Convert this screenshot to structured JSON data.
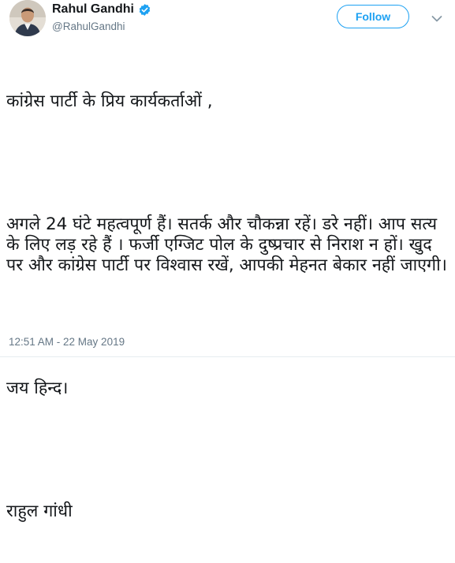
{
  "author": {
    "display_name": "Rahul Gandhi",
    "handle": "@RahulGandhi",
    "verified": true
  },
  "actions": {
    "follow_label": "Follow"
  },
  "icons": {
    "verified": "verified-badge-icon",
    "more": "chevron-down-icon"
  },
  "colors": {
    "accent": "#1da1f2",
    "text": "#14171a",
    "secondary": "#657786"
  },
  "tweet": {
    "paragraphs": [
      "कांग्रेस पार्टी के प्रिय कार्यकर्ताओं ,",
      "अगले 24 घंटे महत्वपूर्ण हैं। सतर्क और चौकन्ना रहें। डरे नहीं। आप सत्य के लिए लड़ रहे हैं । फर्जी एग्जिट पोल के दुष्प्रचार से निराश न हों। खुद पर और कांग्रेस पार्टी पर विश्वास रखें, आपकी मेहनत बेकार नहीं जाएगी।",
      "जय हिन्द।",
      "राहुल गांधी"
    ],
    "timestamp": "12:51 AM - 22 May 2019"
  }
}
